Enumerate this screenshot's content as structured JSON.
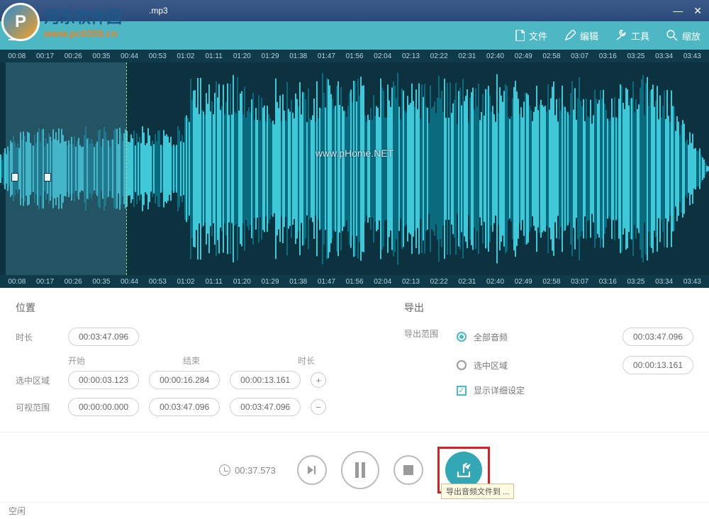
{
  "window": {
    "title": ".mp3",
    "minimize": "—",
    "close": "✕"
  },
  "watermark": {
    "logo_letter": "P",
    "site_name": "河东软件园",
    "site_url": "www.pc0359.cn",
    "center": "www.pHome.NET"
  },
  "toolbar": {
    "file": "文件",
    "edit": "编辑",
    "tools": "工具",
    "zoom": "缩放"
  },
  "ruler_top": [
    "00:08",
    "00:17",
    "00:26",
    "00:35",
    "00:44",
    "00:53",
    "01:02",
    "01:11",
    "01:20",
    "01:29",
    "01:38",
    "01:47",
    "01:56",
    "02:04",
    "02:13",
    "02:22",
    "02:31",
    "02:40",
    "02:49",
    "02:58",
    "03:07",
    "03:16",
    "03:25",
    "03:34",
    "03:43"
  ],
  "ruler_bottom": [
    "00:08",
    "00:17",
    "00:26",
    "00:35",
    "00:44",
    "00:53",
    "01:02",
    "01:11",
    "01:20",
    "01:29",
    "01:38",
    "01:47",
    "01:56",
    "02:04",
    "02:13",
    "02:22",
    "02:31",
    "02:40",
    "02:49",
    "02:58",
    "03:07",
    "03:16",
    "03:25",
    "03:34",
    "03:43"
  ],
  "panel_left": {
    "title": "位置",
    "duration_label": "时长",
    "duration_value": "00:03:47.096",
    "start_label": "开始",
    "end_label": "结束",
    "length_label": "时长",
    "selection_label": "选中区域",
    "selection_start": "00:00:03.123",
    "selection_end": "00:00:16.284",
    "selection_length": "00:00:13.161",
    "visible_label": "可视范围",
    "visible_start": "00:00:00.000",
    "visible_end": "00:03:47.096",
    "visible_length": "00:03:47.096"
  },
  "panel_right": {
    "title": "导出",
    "range_label": "导出范围",
    "all_audio": "全部音频",
    "all_audio_time": "00:03:47.096",
    "selection": "选中区域",
    "selection_time": "00:00:13.161",
    "show_details": "显示详细设定"
  },
  "playback": {
    "time": "00:37.573",
    "tooltip": "导出音频文件到 ..."
  },
  "status": {
    "text": "空闲"
  }
}
